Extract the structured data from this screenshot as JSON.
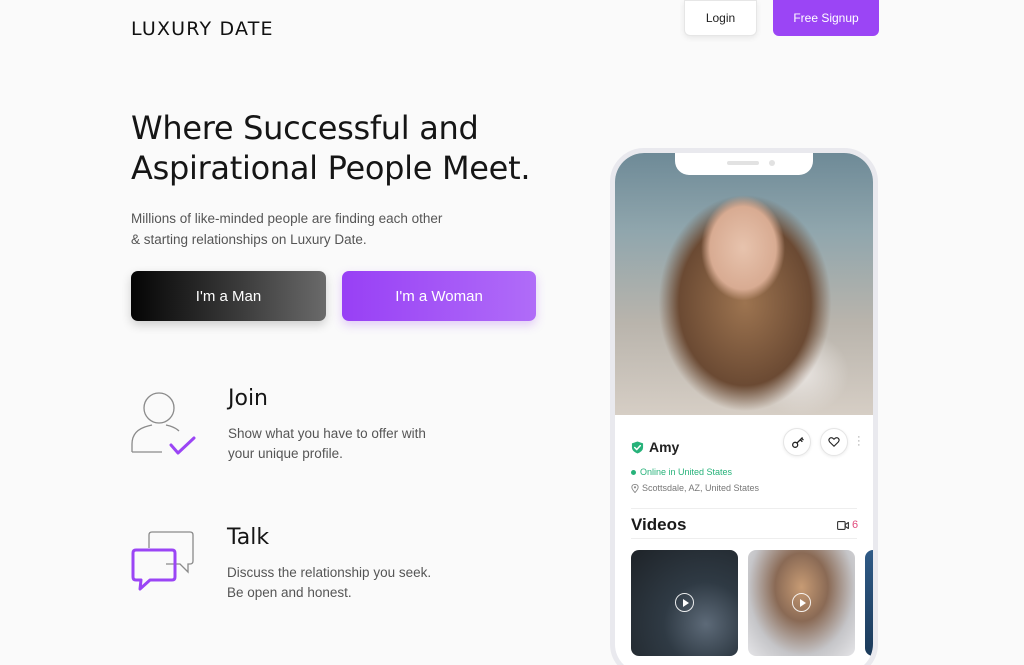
{
  "header": {
    "logo": "LUXURY DATE",
    "login_label": "Login",
    "signup_label": "Free Signup"
  },
  "hero": {
    "title_line1": "Where Successful and",
    "title_line2": "Aspirational People Meet.",
    "subtitle_line1": "Millions of like-minded people are finding each other",
    "subtitle_line2": "& starting relationships on Luxury Date.",
    "man_button": "I'm a Man",
    "woman_button": "I'm a Woman"
  },
  "features": [
    {
      "icon": "user-check-icon",
      "title": "Join",
      "desc_line1": "Show what you have to offer with",
      "desc_line2": "your unique profile."
    },
    {
      "icon": "chat-bubbles-icon",
      "title": "Talk",
      "desc_line1": "Discuss the relationship you seek.",
      "desc_line2": "Be open and honest."
    }
  ],
  "phone": {
    "profile_name": "Amy",
    "status": "Online in United States",
    "location": "Scottsdale, AZ, United States",
    "videos_title": "Videos",
    "videos_count": "6"
  },
  "colors": {
    "accent": "#9b45f5",
    "online": "#27b27a",
    "video_count": "#e14a7c",
    "verify": "#27b27a"
  }
}
